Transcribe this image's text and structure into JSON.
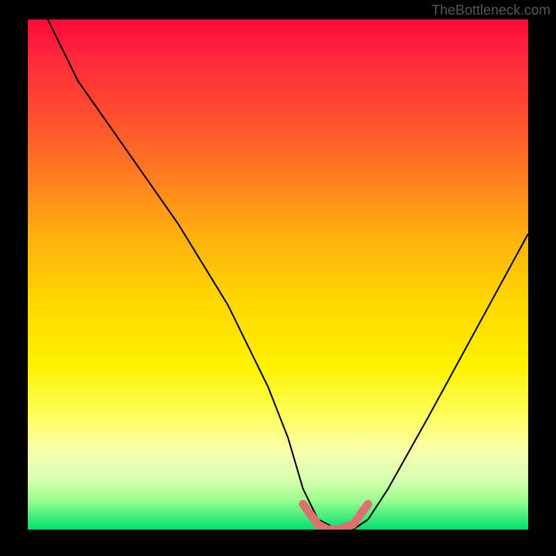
{
  "watermark": "TheBottleneck.com",
  "chart_data": {
    "type": "line",
    "title": "",
    "xlabel": "",
    "ylabel": "",
    "xlim": [
      0,
      100
    ],
    "ylim": [
      0,
      100
    ],
    "series": [
      {
        "name": "curve",
        "x": [
          4,
          10,
          20,
          30,
          40,
          48,
          52,
          55,
          58,
          62,
          65,
          68,
          72,
          80,
          90,
          100
        ],
        "y": [
          100,
          88,
          74,
          60,
          44,
          28,
          18,
          8,
          2,
          0,
          0,
          2,
          8,
          22,
          40,
          58
        ]
      }
    ],
    "highlight": {
      "color": "#e07070",
      "x": [
        55,
        58,
        60,
        62,
        65,
        68
      ],
      "y": [
        5,
        1,
        0,
        0,
        1,
        5
      ]
    },
    "gradient_stops": [
      {
        "pos": 0,
        "color": "#ff0a3a"
      },
      {
        "pos": 50,
        "color": "#ffd600"
      },
      {
        "pos": 85,
        "color": "#ffff80"
      },
      {
        "pos": 100,
        "color": "#00e070"
      }
    ]
  }
}
